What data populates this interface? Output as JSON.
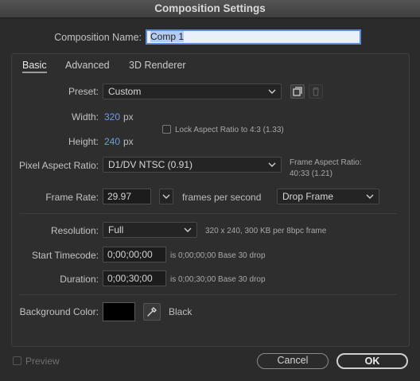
{
  "window": {
    "title": "Composition Settings"
  },
  "composition": {
    "name_label": "Composition Name:",
    "name_value": "Comp 1"
  },
  "tabs": [
    {
      "label": "Basic",
      "active": true
    },
    {
      "label": "Advanced",
      "active": false
    },
    {
      "label": "3D Renderer",
      "active": false
    }
  ],
  "basic": {
    "preset_label": "Preset:",
    "preset_value": "Custom",
    "width_label": "Width:",
    "width_value": "320",
    "width_unit": "px",
    "height_label": "Height:",
    "height_value": "240",
    "height_unit": "px",
    "lock_aspect_label": "Lock Aspect Ratio to 4:3 (1.33)",
    "lock_aspect_checked": false,
    "pixel_aspect_label": "Pixel Aspect Ratio:",
    "pixel_aspect_value": "D1/DV NTSC (0.91)",
    "frame_aspect_title": "Frame Aspect Ratio:",
    "frame_aspect_value": "40:33 (1.21)",
    "frame_rate_label": "Frame Rate:",
    "frame_rate_value": "29.97",
    "frame_rate_unit": "frames per second",
    "drop_frame_value": "Drop Frame",
    "resolution_label": "Resolution:",
    "resolution_value": "Full",
    "resolution_info": "320 x 240, 300 KB per 8bpc frame",
    "start_timecode_label": "Start Timecode:",
    "start_timecode_value": "0;00;00;00",
    "start_timecode_info": "is 0;00;00;00  Base 30  drop",
    "duration_label": "Duration:",
    "duration_value": "0;00;30;00",
    "duration_info": "is 0;00;30;00  Base 30  drop",
    "bg_color_label": "Background Color:",
    "bg_color_value": "#000000",
    "bg_color_name": "Black"
  },
  "footer": {
    "preview_label": "Preview",
    "preview_checked": false,
    "cancel_label": "Cancel",
    "ok_label": "OK"
  },
  "icons": {
    "caret": "chevron-down-icon",
    "new_preset": "new-preset-icon",
    "delete_preset": "trash-icon",
    "eyedropper": "eyedropper-icon"
  }
}
